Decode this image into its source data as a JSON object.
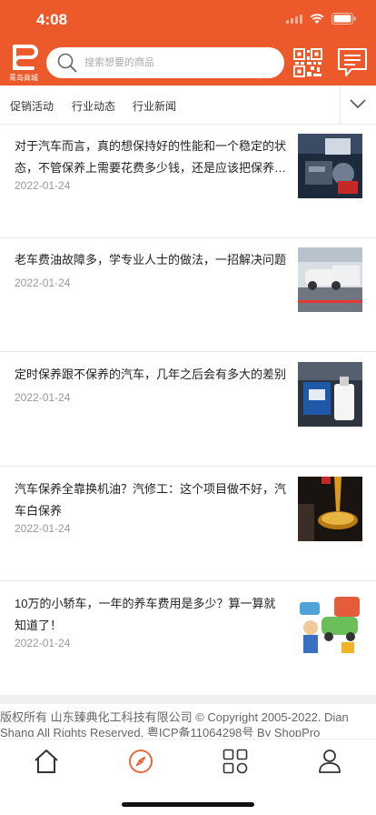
{
  "status": {
    "time": "4:08"
  },
  "header": {
    "logo_text": "青岛商城",
    "search_placeholder": "搜索想要的商品",
    "icons": [
      "qr-code-icon",
      "message-icon"
    ]
  },
  "tabs": [
    "促销活动",
    "行业动态",
    "行业新闻"
  ],
  "news": [
    {
      "title": "对于汽车而言，真的想保持好的性能和一个稳定的状态，不管保养上需要花费多少钱，还是应该把保养…",
      "date": "2022-01-24"
    },
    {
      "title": "老车费油故障多，学专业人士的做法，一招解决问题",
      "date": "2022-01-24"
    },
    {
      "title": "定时保养跟不保养的汽车，几年之后会有多大的差别",
      "date": "2022-01-24"
    },
    {
      "title": "汽车保养全靠换机油？汽修工：这个项目做不好，汽车白保养",
      "date": "2022-01-24"
    },
    {
      "title": "10万的小轿车，一年的养车费用是多少？算一算就知道了！",
      "date": "2022-01-24"
    }
  ],
  "footer": {
    "copyright_line1": "版权所有 山东臻典化工科技有限公司 © Copyright 2005-2022. Dian",
    "copyright_line2": "Shang All Rights Reserved. 粤ICP备11064298号 By ShopPro"
  },
  "tabbar": {
    "icons": [
      "home-icon",
      "compass-icon",
      "grid-icon",
      "user-icon"
    ],
    "active_color": "#ec5a2b"
  },
  "colors": {
    "brand": "#ec5a2b"
  }
}
